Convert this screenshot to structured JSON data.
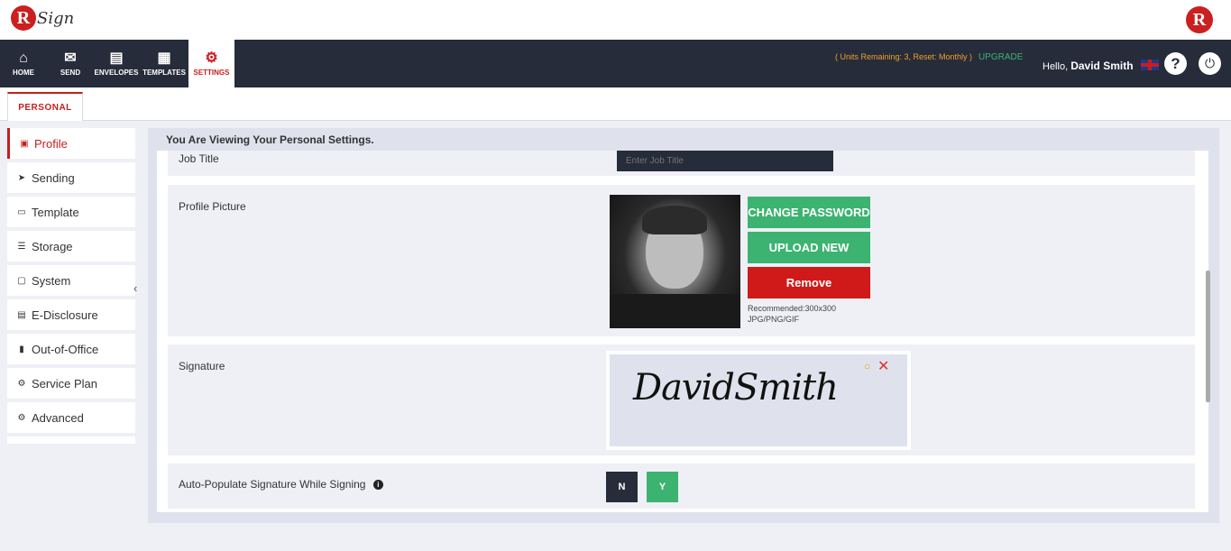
{
  "app": {
    "logo_text": "Sign",
    "logo_letter": "R"
  },
  "nav": {
    "items": [
      {
        "label": "HOME",
        "icon": "home-icon",
        "glyph": "⌂"
      },
      {
        "label": "SEND",
        "icon": "mail-icon",
        "glyph": "✉"
      },
      {
        "label": "ENVELOPES",
        "icon": "envelopes-icon",
        "glyph": "▤"
      },
      {
        "label": "TEMPLATES",
        "icon": "templates-icon",
        "glyph": "▦"
      },
      {
        "label": "SETTINGS",
        "icon": "gear-icon",
        "glyph": "⚙"
      }
    ],
    "active": "SETTINGS"
  },
  "header": {
    "units_text": "( Units Remaining: 3, Reset: Monthly )",
    "upgrade_label": "UPGRADE",
    "hello_prefix": "Hello,",
    "user_name": "David Smith",
    "help_glyph": "?",
    "power_glyph": "⏻"
  },
  "tabs": {
    "personal": "PERSONAL"
  },
  "sidebar": {
    "items": [
      {
        "label": "Profile",
        "glyph": "▣"
      },
      {
        "label": "Sending",
        "glyph": "➤"
      },
      {
        "label": "Template",
        "glyph": "▭"
      },
      {
        "label": "Storage",
        "glyph": "☰"
      },
      {
        "label": "System",
        "glyph": "▢"
      },
      {
        "label": "E-Disclosure",
        "glyph": "▤"
      },
      {
        "label": "Out-of-Office",
        "glyph": "▮"
      },
      {
        "label": "Service Plan",
        "glyph": "⚙"
      },
      {
        "label": "Advanced",
        "glyph": "⚙"
      }
    ],
    "active": "Profile",
    "collapse_glyph": "‹"
  },
  "main": {
    "heading": "You Are Viewing Your Personal Settings.",
    "job_title": {
      "label": "Job Title",
      "placeholder": "Enter Job Title"
    },
    "profile_picture": {
      "label": "Profile Picture",
      "change_password": "CHANGE PASSWORD",
      "upload_new": "UPLOAD NEW",
      "remove": "Remove",
      "recommended": "Recommended:300x300",
      "formats": "JPG/PNG/GIF"
    },
    "signature": {
      "label": "Signature",
      "text": "DavidSmith",
      "edit_glyph": "○",
      "close_glyph": "✕"
    },
    "auto_populate": {
      "label": "Auto-Populate Signature While Signing",
      "info_glyph": "i",
      "no_label": "N",
      "yes_label": "Y"
    }
  },
  "colors": {
    "brand_red": "#c81e1e",
    "nav_dark": "#262c3a",
    "green": "#3cb371",
    "remove_red": "#d01a1a"
  }
}
